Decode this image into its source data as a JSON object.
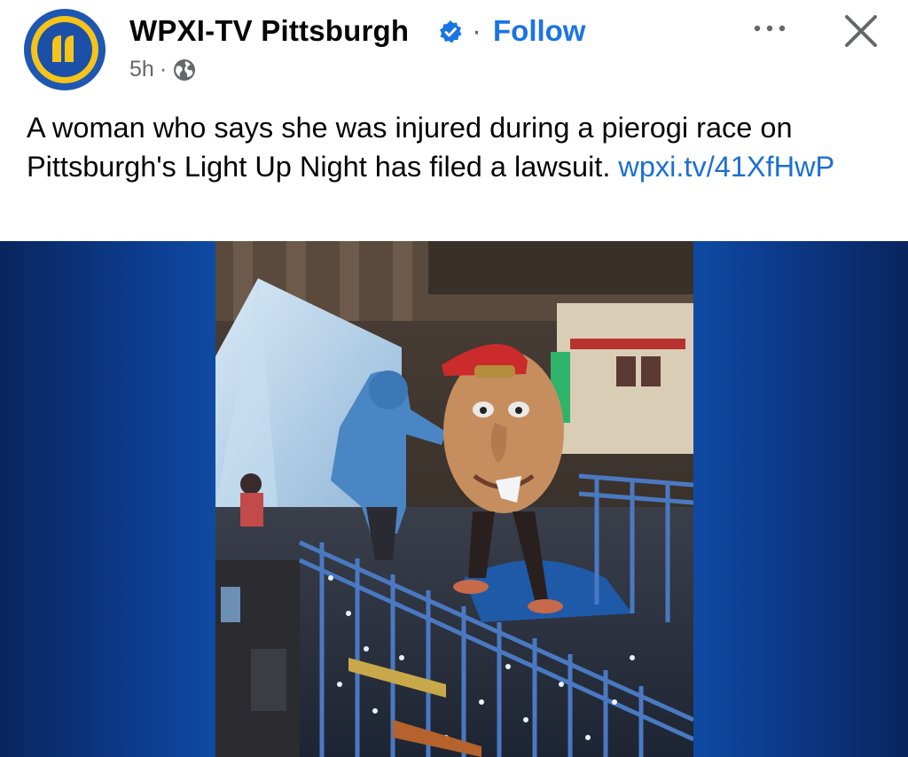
{
  "post": {
    "page_name": "WPXI-TV Pittsburgh",
    "separator": "·",
    "follow_label": "Follow",
    "time": "5h",
    "time_separator": "·",
    "text_before_link": "A woman who says she was injured during a pierogi race on Pittsburgh's Light Up Night has filed a lawsuit. ",
    "link_text": "wpxi.tv/41XfHwP"
  },
  "icons": {
    "verified": "verified-badge-icon",
    "audience": "globe-icon",
    "more": "more-options-icon",
    "close": "close-icon",
    "avatar": "wpxi-logo"
  },
  "colors": {
    "link_blue": "#1b74e4",
    "text": "#050505",
    "secondary": "#65676b",
    "media_blue": "#0a3a8c"
  }
}
